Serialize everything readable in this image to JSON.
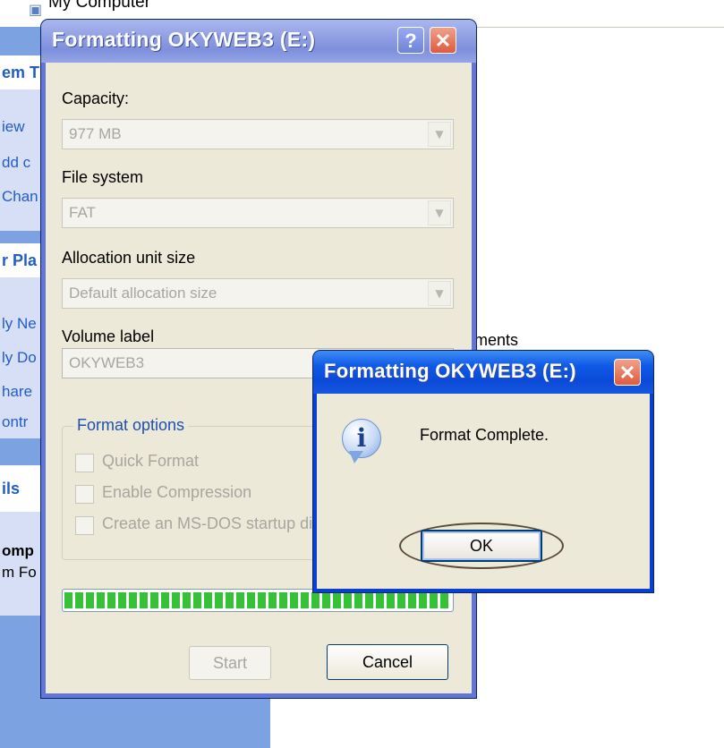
{
  "background": {
    "address_bar": {
      "icon": "computer-icon",
      "text": "My Computer"
    },
    "taskpane": {
      "system_tasks_header": "em T",
      "system_items": [
        "iew",
        "dd c",
        "Chan"
      ],
      "other_places_header": "r Pla",
      "places_items": [
        "ly Ne",
        "ly Do",
        "hare",
        "ontr"
      ],
      "details_header": "ils",
      "details_title": "omp",
      "details_subtitle": "m Fo"
    },
    "partial_text": "ments"
  },
  "format_dialog": {
    "title": "Formatting OKYWEB3 (E:)",
    "help_button": "?",
    "close_button": "✕",
    "capacity_label": "Capacity:",
    "capacity_value": "977 MB",
    "filesystem_label": "File system",
    "filesystem_value": "FAT",
    "allocation_label": "Allocation unit size",
    "allocation_value": "Default allocation size",
    "volume_label_label": "Volume label",
    "volume_label_value": "OKYWEB3",
    "format_options_title": "Format options",
    "quick_format_label": "Quick Format",
    "compression_label": "Enable Compression",
    "msdos_label": "Create an MS-DOS startup disk",
    "progress_percent": 100,
    "start_button": "Start",
    "cancel_button": "Cancel"
  },
  "message_box": {
    "title": "Formatting OKYWEB3 (E:)",
    "close_button": "✕",
    "icon": "information-icon",
    "message": "Format Complete.",
    "ok_button": "OK"
  },
  "colors": {
    "taskpane_blue": "#7ca2e2",
    "dialog_face": "#ece9d8",
    "progress_green": "#36c237",
    "active_title": "#0a4ad8",
    "inactive_title": "#7e8fdc"
  }
}
